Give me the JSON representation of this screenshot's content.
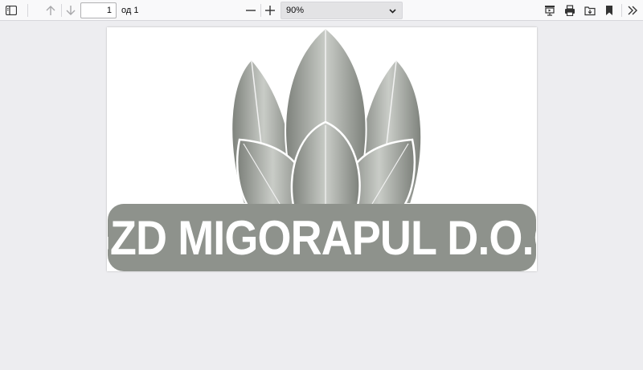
{
  "toolbar": {
    "page_number": "1",
    "page_count": "од 1",
    "zoom_value": "90%"
  },
  "icons": {
    "sidebar": "sidebar-toggle-icon",
    "prev": "arrow-up-icon",
    "next": "arrow-down-icon",
    "zoom_out": "minus-icon",
    "zoom_in": "plus-icon",
    "presentation": "presentation-mode-icon",
    "print": "print-icon",
    "save": "save-icon",
    "bookmark": "bookmark-icon",
    "tools": "double-chevron-icon"
  },
  "document": {
    "banner_text": "GZD MIGORAPUL D.O.O",
    "banner_color": "#8e928c",
    "leaf_color": "#9a9e98"
  }
}
